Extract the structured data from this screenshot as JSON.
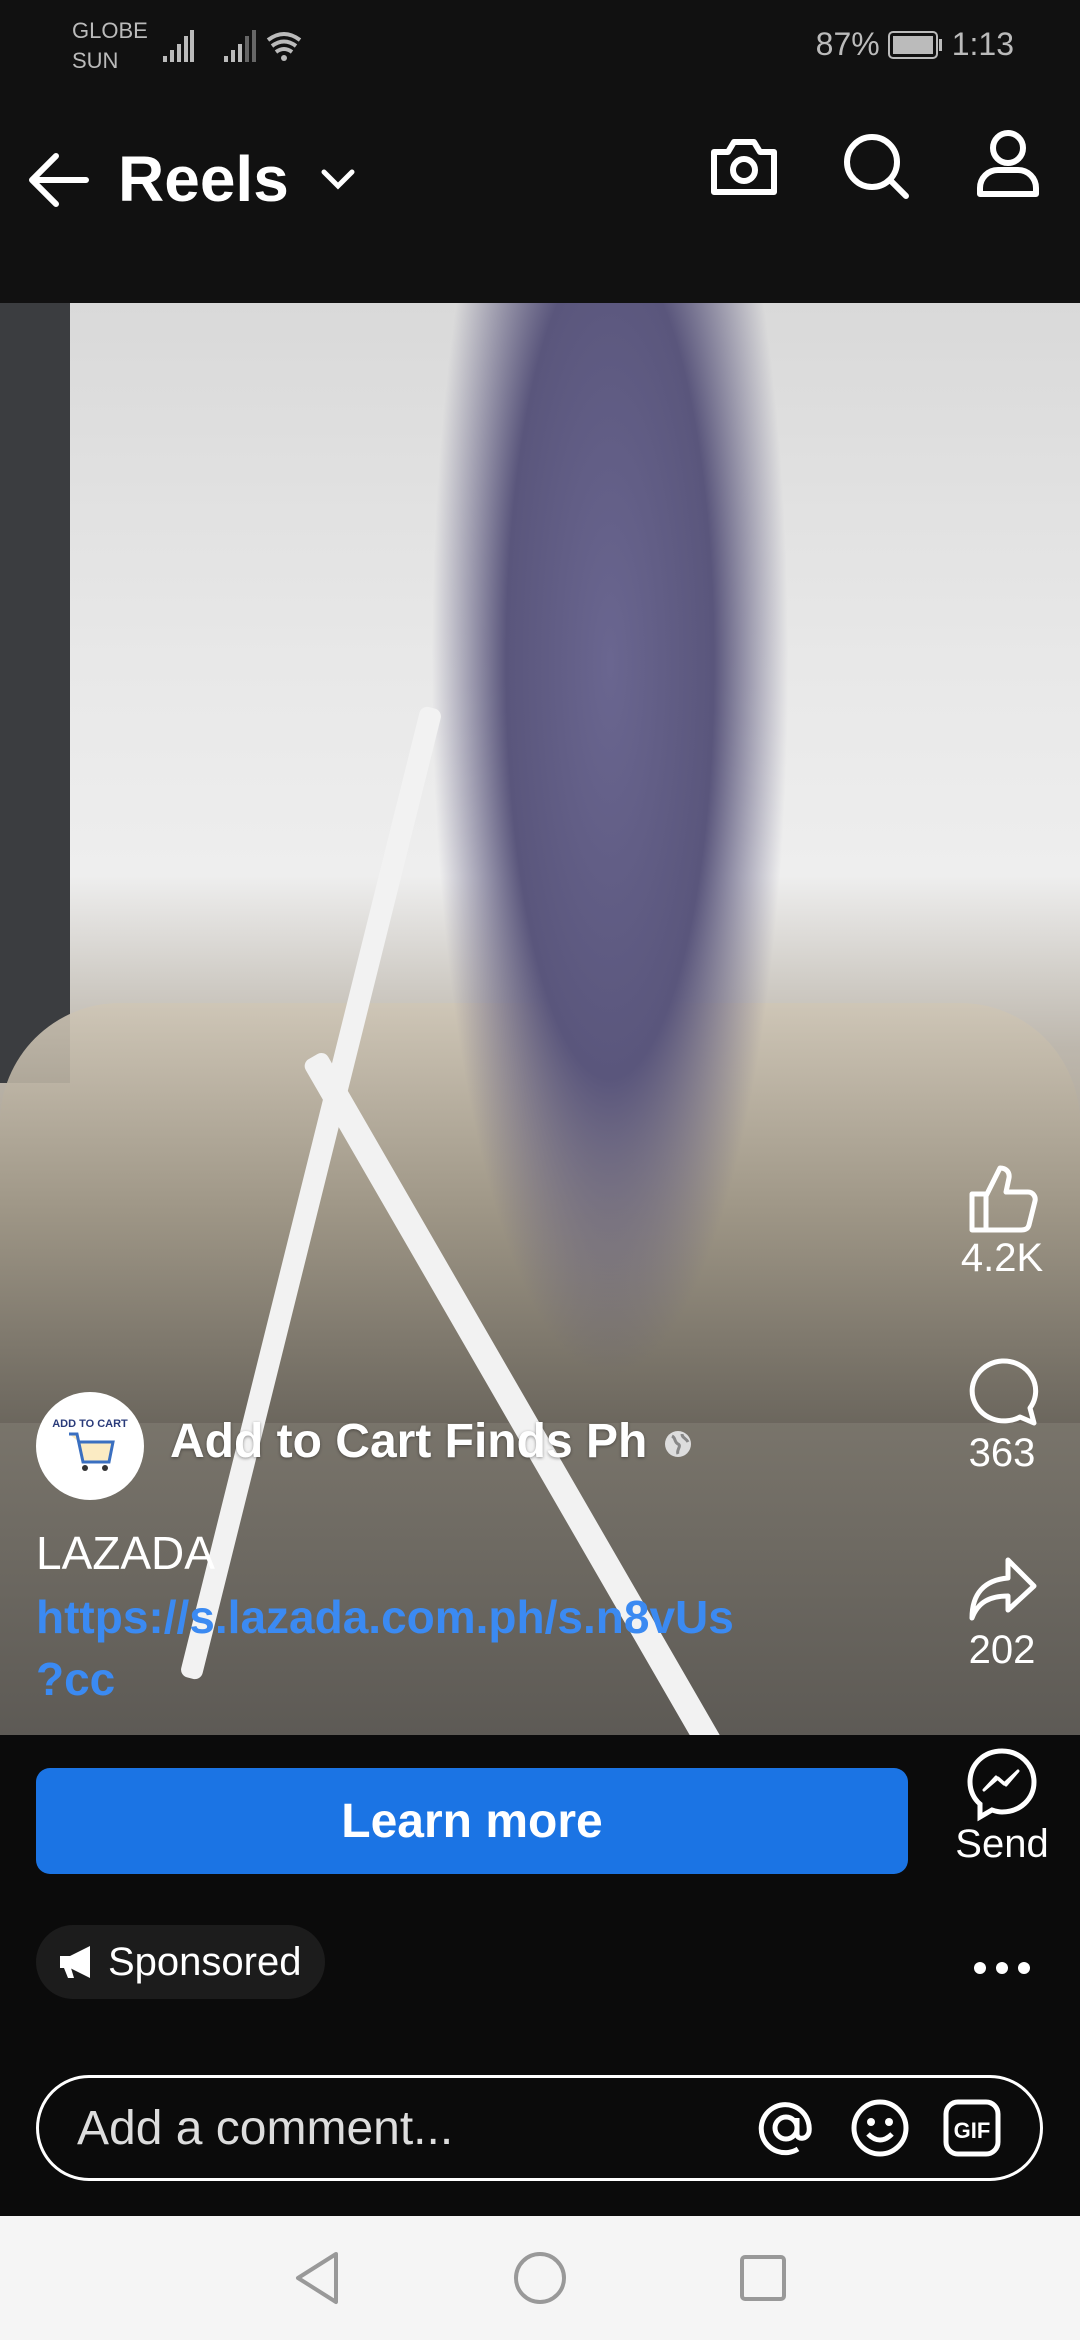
{
  "status_bar": {
    "carrier1": "GLOBE",
    "carrier2": "SUN",
    "battery": "87%",
    "time": "1:13"
  },
  "header": {
    "title": "Reels",
    "icons": [
      "back-arrow-icon",
      "chevron-down-icon",
      "camera-icon",
      "search-icon",
      "profile-icon"
    ]
  },
  "post": {
    "author": "Add to Cart Finds Ph",
    "avatar_text": "ADD TO CART",
    "caption": "LAZADA",
    "link_line1": "https://s.lazada.com.ph/s.n8vUs",
    "link_line2": "?cc",
    "link_color": "#3b8af2"
  },
  "actions": {
    "likes": "4.2K",
    "comments": "363",
    "shares": "202",
    "send": "Send"
  },
  "cta": {
    "label": "Learn more",
    "color": "#1b74e4"
  },
  "sponsored": "Sponsored",
  "comment": {
    "placeholder": "Add a comment..."
  }
}
